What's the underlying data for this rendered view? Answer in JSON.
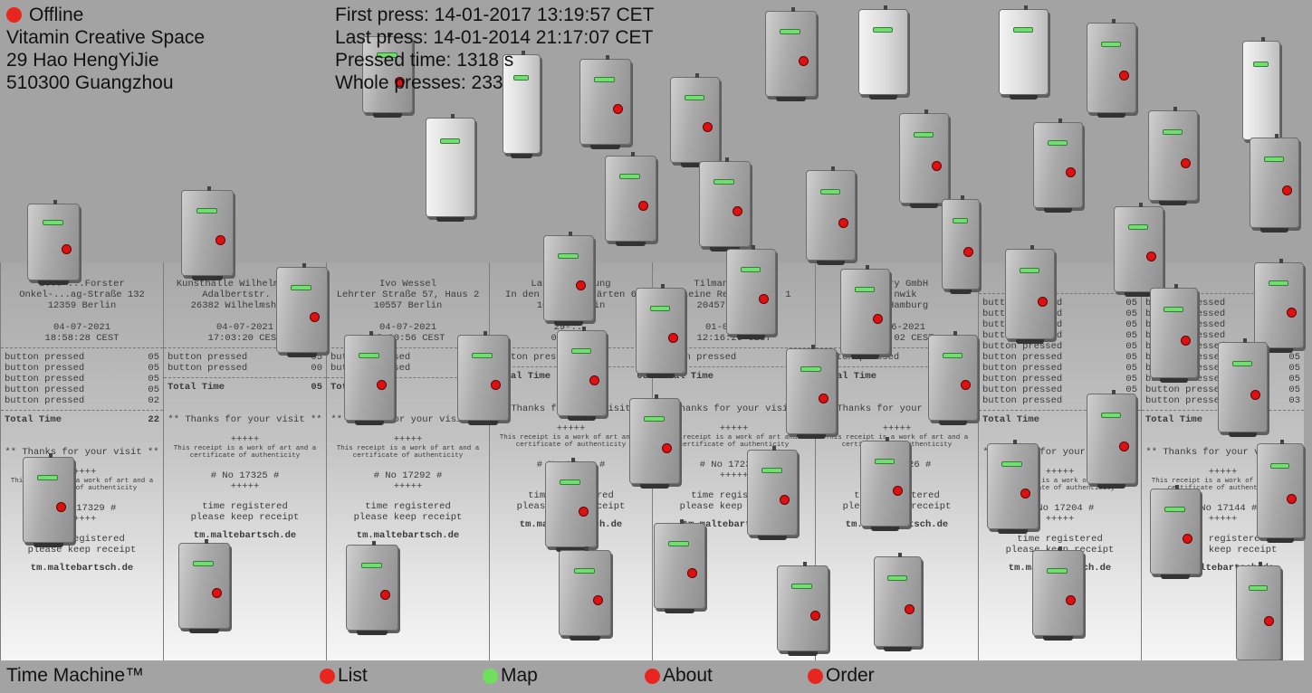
{
  "status": {
    "label": "Offline",
    "color": "#e8261f"
  },
  "venue": {
    "name": "Vitamin Creative Space",
    "street": "29 Hao HengYiJie",
    "city": "510300 Guangzhou"
  },
  "press": {
    "first": "First press: 14-01-2017 13:19:57 CET",
    "last": "Last press: 14-01-2014 21:17:07 CET",
    "pressed_time": "Pressed time: 1318 s",
    "whole": "Whole presses: 233"
  },
  "receipts": [
    {
      "name": "S... ...Forster",
      "street": "Onkel-...ag-Straße 132",
      "city": "12359 Berlin",
      "date": "04-07-2021",
      "time": "18:58:28 CEST",
      "lines": [
        [
          "button pressed",
          "05"
        ],
        [
          "button pressed",
          "05"
        ],
        [
          "button pressed",
          "05"
        ],
        [
          "button pressed",
          "05"
        ],
        [
          "button pressed",
          "02"
        ]
      ],
      "total_label": "Total Time",
      "total": "22",
      "thanks": "** Thanks for your visit **",
      "plus": "+++++",
      "art1": "This receipt is a work of art and a",
      "art2": "certificate of authenticity",
      "number": "# No 17329 #",
      "reg1": "time registered",
      "reg2": "please keep receipt",
      "url": "tm.maltebartsch.de"
    },
    {
      "name": "Kunsthalle Wilhelmshaven",
      "street": "Adalbertstr. 28",
      "city": "26382 Wilhelmshaven",
      "date": "04-07-2021",
      "time": "17:03:20 CEST",
      "lines": [
        [
          "button pressed",
          "05"
        ],
        [
          "button pressed",
          "00"
        ]
      ],
      "total_label": "Total Time",
      "total": "05",
      "thanks": "** Thanks for your visit **",
      "plus": "+++++",
      "art1": "This receipt is a work of art and a",
      "art2": "certificate of authenticity",
      "number": "# No 17325 #",
      "reg1": "time registered",
      "reg2": "please keep receipt",
      "url": "tm.maltebartsch.de"
    },
    {
      "name": "Ivo Wessel",
      "street": "Lehrter Straße 57, Haus 2",
      "city": "10557 Berlin",
      "date": "04-07-2021",
      "time": "15:20:56 CEST",
      "lines": [
        [
          "button pressed",
          "05"
        ],
        [
          "button pressed",
          "02"
        ]
      ],
      "total_label": "Total Time",
      "total": "07",
      "thanks": "** Thanks for your visit **",
      "plus": "+++++",
      "art1": "This receipt is a work of art and a",
      "art2": "certificate of authenticity",
      "number": "# No 17292 #",
      "reg1": "time registered",
      "reg2": "please keep receipt",
      "url": "tm.maltebartsch.de"
    },
    {
      "name": "Landes...stung",
      "street": "In den Ministergärten 6",
      "city": "10117 Berlin",
      "date": "29-...",
      "time": "05:0...",
      "lines": [
        [
          "button pressed",
          "03"
        ]
      ],
      "total_label": "Total Time",
      "total": "03",
      "thanks": "** Thanks for your visit **",
      "plus": "+++++",
      "art1": "This receipt is a work of art and a",
      "art2": "certificate of authenticity",
      "number": "# No 17... #",
      "reg1": "time registered",
      "reg2": "please keep receipt",
      "url": "tm.maltebartsch.de"
    },
    {
      "name": "Tilman... GmbH",
      "street": "Kleine Reichenstr. 1",
      "city": "20457 Hamburg",
      "date": "01-07-2021",
      "time": "12:16:26 CEST",
      "lines": [
        [
          "button pressed",
          "01"
        ]
      ],
      "total_label": "Total Time",
      "total": "01",
      "thanks": "** Thanks for your visit **",
      "plus": "+++++",
      "art1": "This receipt is a work of art and a",
      "art2": "certificate of authenticity",
      "number": "# No 17237 #",
      "reg1": "time registered",
      "reg2": "please keep receipt",
      "url": "tm.maltebartsch.de"
    },
    {
      "name": "...ery GmbH",
      "street": "...nwik",
      "city": "... Hamburg",
      "date": "29-06-2021",
      "time": "19:53:02 CEST",
      "lines": [
        [
          "button pressed",
          "03"
        ]
      ],
      "total_label": "Total Time",
      "total": "03",
      "thanks": "** Thanks for your visit **",
      "plus": "+++++",
      "art1": "This receipt is a work of art and a",
      "art2": "certificate of authenticity",
      "number": "# No 17226 #",
      "reg1": "time registered",
      "reg2": "please keep receipt",
      "url": "tm.maltebartsch.de"
    },
    {
      "name": "",
      "street": "",
      "city": "",
      "date": "",
      "time": "",
      "lines": [
        [
          "button pressed",
          "05"
        ],
        [
          "button pressed",
          "05"
        ],
        [
          "button pressed",
          "05"
        ],
        [
          "button pressed",
          "05"
        ],
        [
          "button pressed",
          "05"
        ],
        [
          "button pressed",
          "05"
        ],
        [
          "button pressed",
          "05"
        ],
        [
          "button pressed",
          "05"
        ],
        [
          "button pressed",
          "05"
        ],
        [
          "button pressed",
          "05"
        ]
      ],
      "total_label": "Total Time",
      "total": "",
      "thanks": "** Thanks for your visit **",
      "plus": "+++++",
      "art1": "This receipt is a work of art and a",
      "art2": "certificate of authenticity",
      "number": "# No 17204 #",
      "reg1": "time registered",
      "reg2": "please keep receipt",
      "url": "tm.maltebartsch.de"
    },
    {
      "name": "",
      "street": "",
      "city": "",
      "date": "",
      "time": "",
      "lines": [
        [
          "button pressed",
          "05"
        ],
        [
          "button pressed",
          "05"
        ],
        [
          "button pressed",
          "05"
        ],
        [
          "button pressed",
          "05"
        ],
        [
          "button pressed",
          "05"
        ],
        [
          "button pressed",
          "05"
        ],
        [
          "button pressed",
          "05"
        ],
        [
          "button pressed",
          "05"
        ],
        [
          "button pressed",
          "05"
        ],
        [
          "button pressed",
          "03"
        ]
      ],
      "total_label": "Total Time",
      "total": "",
      "thanks": "** Thanks for your visit **",
      "plus": "+++++",
      "art1": "This receipt is a work of art and a",
      "art2": "certificate of authenticity",
      "number": "# No 17144 #",
      "reg1": "time registered",
      "reg2": "please keep receipt",
      "url": "tm.maltebartsch.de"
    }
  ],
  "footer": {
    "title": "Time Machine™",
    "nav": [
      {
        "label": "List",
        "color": "#e8261f"
      },
      {
        "label": "Map",
        "color": "#6ee05c"
      },
      {
        "label": "About",
        "color": "#e8261f"
      },
      {
        "label": "Order",
        "color": "#e8261f"
      }
    ]
  }
}
